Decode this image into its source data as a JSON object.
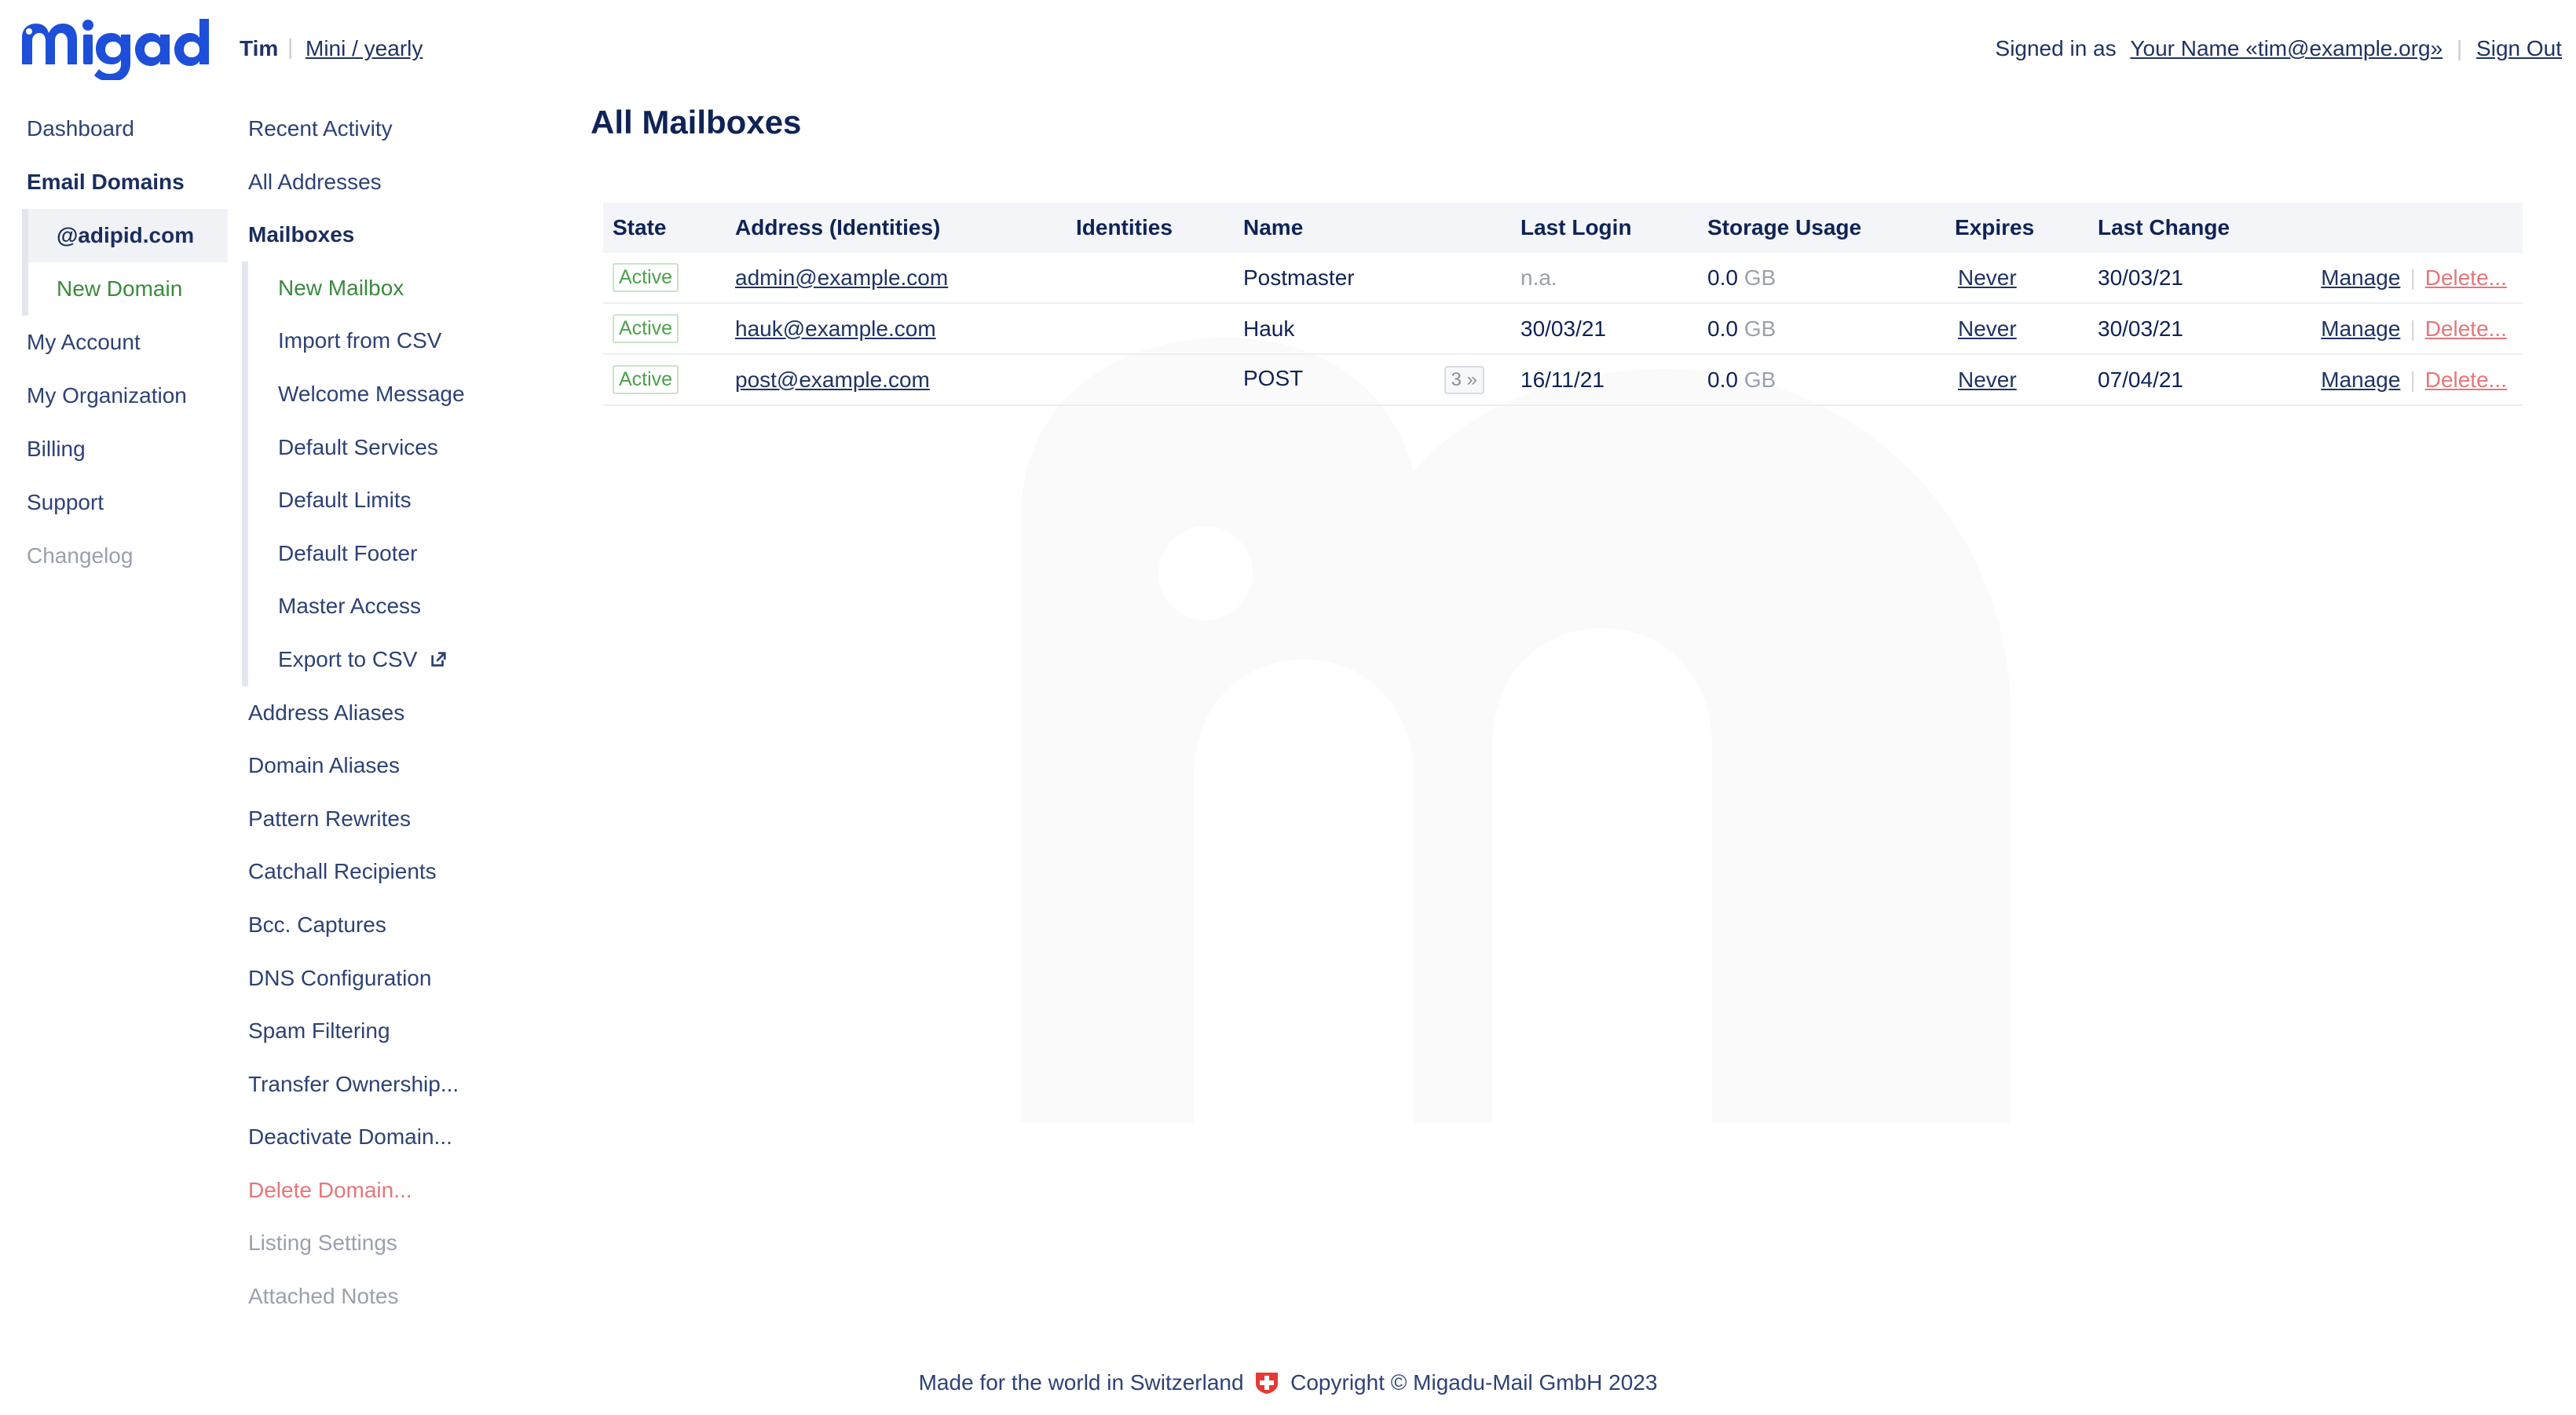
{
  "header": {
    "account_name": "Tim",
    "plan": "Mini / yearly",
    "signed_in_as_label": "Signed in as",
    "user": "Your Name «tim@example.org»",
    "sign_out": "Sign Out"
  },
  "nav_primary": {
    "dashboard": "Dashboard",
    "email_domains": "Email Domains",
    "domain": "@adipid.com",
    "new_domain": "New Domain",
    "my_account": "My Account",
    "my_organization": "My Organization",
    "billing": "Billing",
    "support": "Support",
    "changelog": "Changelog"
  },
  "nav_secondary": {
    "recent_activity": "Recent Activity",
    "all_addresses": "All Addresses",
    "mailboxes": "Mailboxes",
    "mailbox_sub": {
      "new_mailbox": "New Mailbox",
      "import_csv": "Import from CSV",
      "welcome_message": "Welcome Message",
      "default_services": "Default Services",
      "default_limits": "Default Limits",
      "default_footer": "Default Footer",
      "master_access": "Master Access",
      "export_csv": "Export to CSV"
    },
    "address_aliases": "Address Aliases",
    "domain_aliases": "Domain Aliases",
    "pattern_rewrites": "Pattern Rewrites",
    "catchall_recipients": "Catchall Recipients",
    "bcc_captures": "Bcc. Captures",
    "dns_configuration": "DNS Configuration",
    "spam_filtering": "Spam Filtering",
    "transfer_ownership": "Transfer Ownership...",
    "deactivate_domain": "Deactivate Domain...",
    "delete_domain": "Delete Domain...",
    "listing_settings": "Listing Settings",
    "attached_notes": "Attached Notes"
  },
  "main": {
    "title": "All Mailboxes",
    "columns": {
      "state": "State",
      "address": "Address (Identities)",
      "identities": "Identities",
      "name": "Name",
      "last_login": "Last Login",
      "storage": "Storage Usage",
      "expires": "Expires",
      "last_change": "Last Change"
    },
    "rows": [
      {
        "state": "Active",
        "address": "admin@example.com",
        "name": "Postmaster",
        "identities_count": "",
        "last_login": "n.a.",
        "storage_value": "0.0",
        "storage_unit": "GB",
        "expires": "Never",
        "last_change": "30/03/21",
        "manage": "Manage",
        "delete": "Delete..."
      },
      {
        "state": "Active",
        "address": "hauk@example.com",
        "name": "Hauk",
        "identities_count": "",
        "last_login": "30/03/21",
        "storage_value": "0.0",
        "storage_unit": "GB",
        "expires": "Never",
        "last_change": "30/03/21",
        "manage": "Manage",
        "delete": "Delete..."
      },
      {
        "state": "Active",
        "address": "post@example.com",
        "name": "POST",
        "identities_count": "3 »",
        "last_login": "16/11/21",
        "storage_value": "0.0",
        "storage_unit": "GB",
        "expires": "Never",
        "last_change": "07/04/21",
        "manage": "Manage",
        "delete": "Delete..."
      }
    ]
  },
  "footer": {
    "made_in": "Made for the world in Switzerland",
    "copyright": "Copyright © Migadu-Mail GmbH 2023"
  },
  "colors": {
    "brand": "#1d4fd8",
    "nav_text": "#2d4275",
    "active_green": "#4ca24c",
    "delete_red": "#e5777a",
    "header_row_bg": "#f4f5f8"
  },
  "icons": {
    "logo": "migadu-logo",
    "export": "external-link-icon",
    "flag": "swiss-flag-icon"
  }
}
